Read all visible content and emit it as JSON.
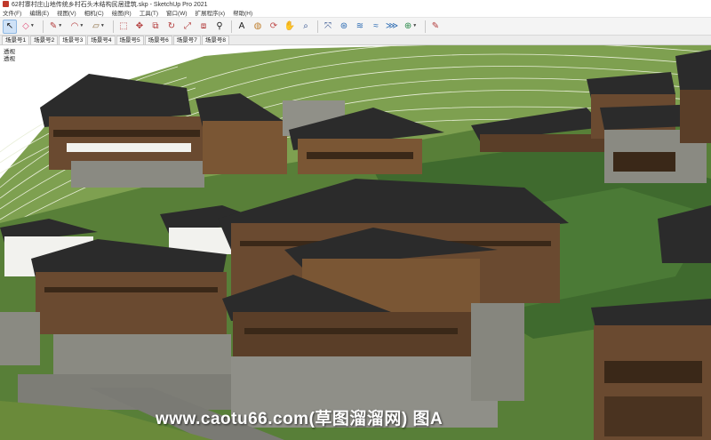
{
  "window": {
    "title": "62村寨村庄山地传统乡村石头木结构民居建筑.skp - SketchUp Pro 2021"
  },
  "menu": {
    "items": [
      "文件(F)",
      "编辑(E)",
      "视图(V)",
      "相机(C)",
      "绘图(R)",
      "工具(T)",
      "窗口(W)",
      "扩展程序(x)",
      "帮助(H)"
    ]
  },
  "toolbar": {
    "tools": [
      {
        "name": "select-tool",
        "glyph": "↖",
        "color": "#1a1a1a",
        "active": true,
        "dropdown": false
      },
      {
        "name": "eraser-tool",
        "glyph": "◇",
        "color": "#e0507a",
        "active": false,
        "dropdown": true
      },
      {
        "name": "pencil-line-tool",
        "glyph": "✎",
        "color": "#b23a3a",
        "active": false,
        "dropdown": true
      },
      {
        "name": "arc-tool",
        "glyph": "◠",
        "color": "#b23a3a",
        "active": false,
        "dropdown": true
      },
      {
        "name": "rectangle-tool",
        "glyph": "▱",
        "color": "#8a6a40",
        "active": false,
        "dropdown": true
      },
      {
        "name": "push-pull-tool",
        "glyph": "⬚",
        "color": "#b23a3a",
        "active": false,
        "dropdown": false
      },
      {
        "name": "move-tool",
        "glyph": "✥",
        "color": "#b23a3a",
        "active": false,
        "dropdown": false
      },
      {
        "name": "follow-me-tool",
        "glyph": "⧉",
        "color": "#b23a3a",
        "active": false,
        "dropdown": false
      },
      {
        "name": "rotate-tool",
        "glyph": "↻",
        "color": "#b23a3a",
        "active": false,
        "dropdown": false
      },
      {
        "name": "scale-tool",
        "glyph": "⤢",
        "color": "#b23a3a",
        "active": false,
        "dropdown": false
      },
      {
        "name": "offset-tool",
        "glyph": "⧈",
        "color": "#b23a3a",
        "active": false,
        "dropdown": false
      },
      {
        "name": "tape-measure-tool",
        "glyph": "⚲",
        "color": "#1a1a1a",
        "active": false,
        "dropdown": false
      },
      {
        "name": "text-tool",
        "glyph": "A",
        "color": "#1a1a1a",
        "active": false,
        "dropdown": false
      },
      {
        "name": "paint-bucket-tool",
        "glyph": "◍",
        "color": "#c08030",
        "active": false,
        "dropdown": false
      },
      {
        "name": "orbit-tool",
        "glyph": "⟳",
        "color": "#c05050",
        "active": false,
        "dropdown": false
      },
      {
        "name": "pan-tool",
        "glyph": "✋",
        "color": "#c09050",
        "active": false,
        "dropdown": false
      },
      {
        "name": "zoom-tool",
        "glyph": "⌕",
        "color": "#2a4a8a",
        "active": false,
        "dropdown": false
      },
      {
        "name": "zoom-extents-tool",
        "glyph": "⤧",
        "color": "#2a4a8a",
        "active": false,
        "dropdown": false
      },
      {
        "name": "components-tool",
        "glyph": "⊛",
        "color": "#2a6ab2",
        "active": false,
        "dropdown": false
      },
      {
        "name": "materials-tool",
        "glyph": "≋",
        "color": "#2a6ab2",
        "active": false,
        "dropdown": false
      },
      {
        "name": "styles-tool",
        "glyph": "≈",
        "color": "#2a6ab2",
        "active": false,
        "dropdown": false
      },
      {
        "name": "layers-tool",
        "glyph": "⋙",
        "color": "#2a6ab2",
        "active": false,
        "dropdown": false
      },
      {
        "name": "geo-location-tool",
        "glyph": "⊕",
        "color": "#2a8a4a",
        "active": false,
        "dropdown": true
      },
      {
        "name": "edit-note-tool",
        "glyph": "✎",
        "color": "#b23a3a",
        "active": false,
        "dropdown": false
      }
    ]
  },
  "scenes": {
    "tabs": [
      "场景号1",
      "场景号2",
      "场景号3",
      "场景号4",
      "场景号5",
      "场景号6",
      "场景号7",
      "场景号8"
    ],
    "active": "场景号3"
  },
  "viewport": {
    "label_line1": "透视",
    "label_line2": "透视",
    "colors": {
      "terrain": "#6e9148",
      "terrain_dark": "#3f6a2e",
      "contour": "#e8eed8",
      "timber": "#5a3e28",
      "timber_dark": "#3a2818",
      "roof": "#2b2b2b",
      "stone": "#8a8a82",
      "plaster": "#f2f2ee"
    }
  },
  "watermark": {
    "text": "www.caotu66.com(草图溜溜网) 图A"
  }
}
